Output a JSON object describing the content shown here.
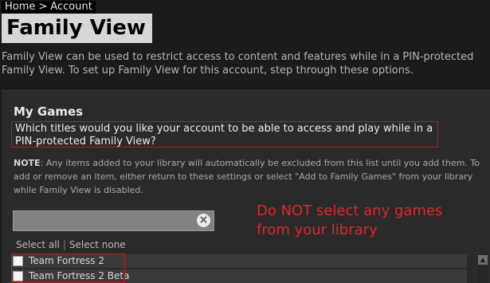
{
  "breadcrumb": {
    "home": "Home",
    "separator": ">",
    "current": "Account"
  },
  "page": {
    "title": "Family View"
  },
  "intro": "Family View can be used to restrict access to content and features while in a PIN-protected Family View. To set up Family View for this account, step through these options.",
  "my_games": {
    "title": "My Games",
    "question": "Which titles would you like your account to be able to access and play while in a PIN-protected Family View?",
    "note_label": "NOTE",
    "note_text": ": Any items added to your library will automatically be excluded from this list until you add them. To add or remove an item, either return to these settings or select \"Add to Family Games\" from your library while Family View is disabled.",
    "search": {
      "value": ""
    },
    "select_all": "Select all",
    "select_divider": "|",
    "select_none": "Select none",
    "games": [
      {
        "name": "Team Fortress 2",
        "checked": false
      },
      {
        "name": "Team Fortress 2 Beta",
        "checked": false
      }
    ]
  },
  "annotation": "Do NOT select any games from your library",
  "colors": {
    "annotation": "#e0262b",
    "outline": "#c8161d"
  },
  "icons": {
    "clear": "clear-icon",
    "scroll_up": "scroll-up-arrow-icon"
  }
}
